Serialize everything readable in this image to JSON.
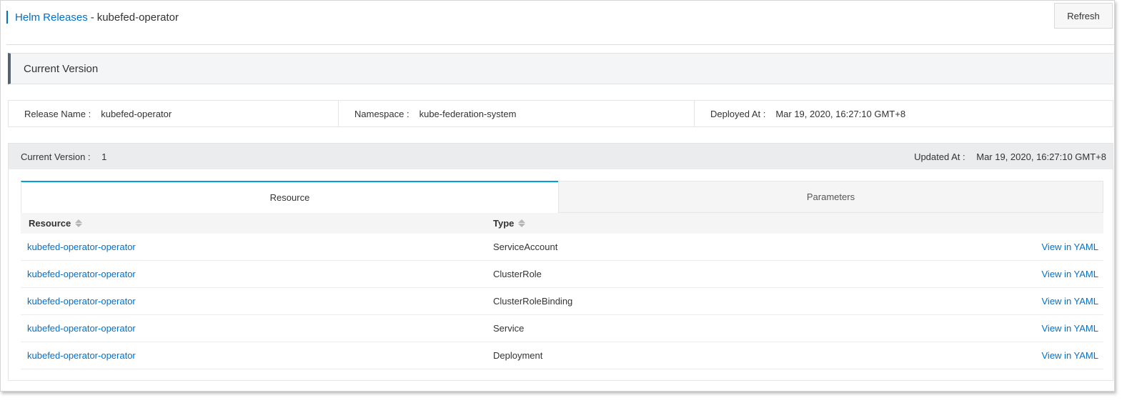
{
  "header": {
    "breadcrumb_link": "Helm Releases",
    "separator": "-",
    "current": "kubefed-operator",
    "refresh_label": "Refresh"
  },
  "section": {
    "title": "Current Version"
  },
  "info": {
    "release_name_label": "Release Name :",
    "release_name": "kubefed-operator",
    "namespace_label": "Namespace :",
    "namespace": "kube-federation-system",
    "deployed_at_label": "Deployed At :",
    "deployed_at": "Mar 19, 2020, 16:27:10 GMT+8"
  },
  "version": {
    "current_label": "Current Version :",
    "current": "1",
    "updated_label": "Updated At :",
    "updated_at": "Mar 19, 2020, 16:27:10 GMT+8"
  },
  "tabs": [
    {
      "label": "Resource",
      "active": true
    },
    {
      "label": "Parameters",
      "active": false
    }
  ],
  "table": {
    "columns": [
      "Resource",
      "Type"
    ],
    "rows": [
      {
        "resource": "kubefed-operator-operator",
        "type": "ServiceAccount",
        "action": "View in YAML"
      },
      {
        "resource": "kubefed-operator-operator",
        "type": "ClusterRole",
        "action": "View in YAML"
      },
      {
        "resource": "kubefed-operator-operator",
        "type": "ClusterRoleBinding",
        "action": "View in YAML"
      },
      {
        "resource": "kubefed-operator-operator",
        "type": "Service",
        "action": "View in YAML"
      },
      {
        "resource": "kubefed-operator-operator",
        "type": "Deployment",
        "action": "View in YAML"
      }
    ]
  },
  "colors": {
    "link": "#0070cc",
    "accent_tab": "#00a1d6",
    "title_bar": "#566270"
  }
}
